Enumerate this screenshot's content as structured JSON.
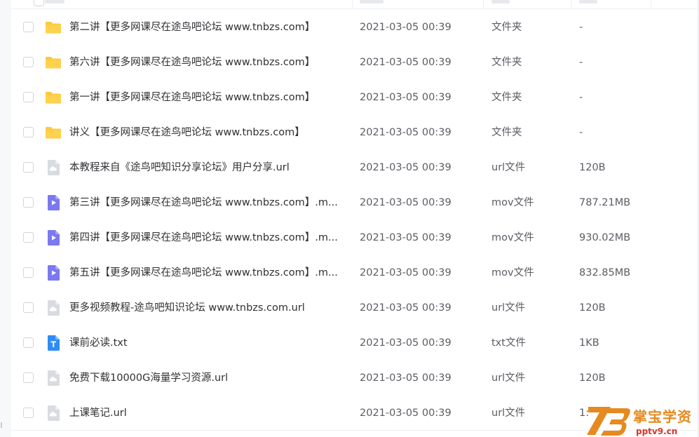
{
  "files": [
    {
      "kind": "folder",
      "icon": "folder-icon",
      "name": "第二讲【更多网课尽在途鸟吧论坛 www.tnbzs.com】",
      "date": "2021-03-05 00:39",
      "type": "文件夹",
      "size": "-"
    },
    {
      "kind": "folder",
      "icon": "folder-icon",
      "name": "第六讲【更多网课尽在途鸟吧论坛 www.tnbzs.com】",
      "date": "2021-03-05 00:39",
      "type": "文件夹",
      "size": "-"
    },
    {
      "kind": "folder",
      "icon": "folder-icon",
      "name": "第一讲【更多网课尽在途鸟吧论坛 www.tnbzs.com】",
      "date": "2021-03-05 00:39",
      "type": "文件夹",
      "size": "-"
    },
    {
      "kind": "folder",
      "icon": "folder-icon",
      "name": "讲义【更多网课尽在途鸟吧论坛 www.tnbzs.com】",
      "date": "2021-03-05 00:39",
      "type": "文件夹",
      "size": "-"
    },
    {
      "kind": "url",
      "icon": "url-file-icon",
      "name": "本教程来自《途鸟吧知识分享论坛》用户分享.url",
      "date": "2021-03-05 00:39",
      "type": "url文件",
      "size": "120B"
    },
    {
      "kind": "video",
      "icon": "video-file-icon",
      "name": "第三讲【更多网课尽在途鸟吧论坛 www.tnbzs.com】.m...",
      "date": "2021-03-05 00:39",
      "type": "mov文件",
      "size": "787.21MB"
    },
    {
      "kind": "video",
      "icon": "video-file-icon",
      "name": "第四讲【更多网课尽在途鸟吧论坛 www.tnbzs.com】.m...",
      "date": "2021-03-05 00:39",
      "type": "mov文件",
      "size": "930.02MB"
    },
    {
      "kind": "video",
      "icon": "video-file-icon",
      "name": "第五讲【更多网课尽在途鸟吧论坛 www.tnbzs.com】.m...",
      "date": "2021-03-05 00:39",
      "type": "mov文件",
      "size": "832.85MB"
    },
    {
      "kind": "url",
      "icon": "url-file-icon",
      "name": "更多视频教程-途鸟吧知识论坛 www.tnbzs.com.url",
      "date": "2021-03-05 00:39",
      "type": "url文件",
      "size": "120B"
    },
    {
      "kind": "text",
      "icon": "text-file-icon",
      "name": "课前必读.txt",
      "date": "2021-03-05 00:39",
      "type": "txt文件",
      "size": "1KB"
    },
    {
      "kind": "url",
      "icon": "url-file-icon",
      "name": "免费下载10000G海量学习资源.url",
      "date": "2021-03-05 00:39",
      "type": "url文件",
      "size": "120B"
    },
    {
      "kind": "url",
      "icon": "url-file-icon",
      "name": "上课笔记.url",
      "date": "2021-03-05 00:39",
      "type": "url文件",
      "size": "1:"
    }
  ],
  "watermark": {
    "logo_text": "73",
    "text": "掌宝学资",
    "url": "pptv9.cn"
  },
  "colors": {
    "folder": "#fcc93c",
    "video": "#7b78f2",
    "url_file": "#d8dbe0",
    "text_file": "#2f8cf6",
    "watermark_orange": "#e58a1f",
    "watermark_red": "#d9342b"
  }
}
